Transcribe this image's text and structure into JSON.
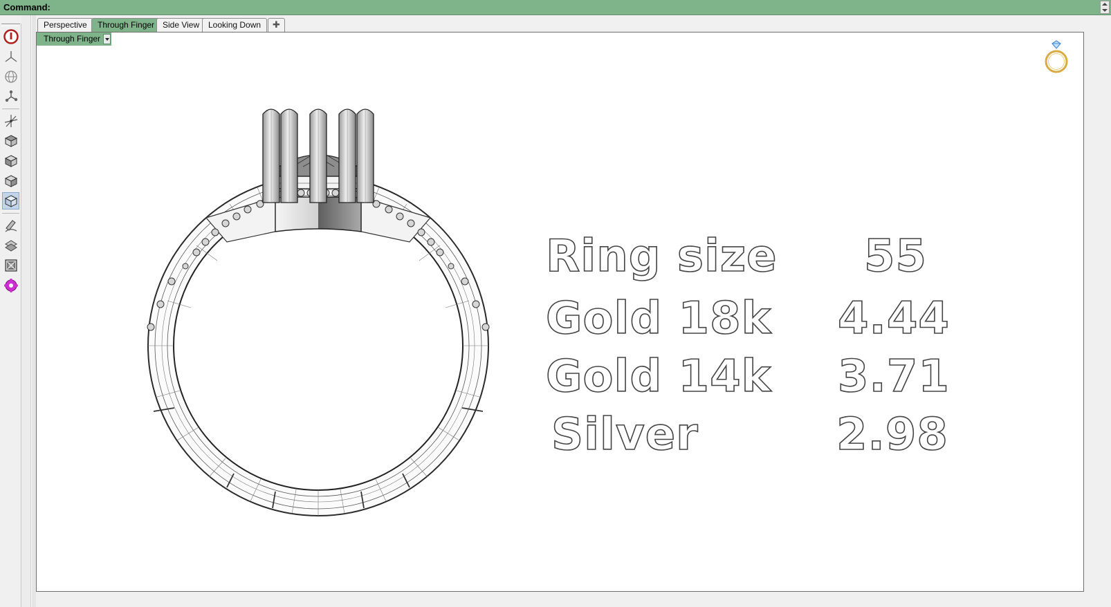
{
  "command": {
    "label": "Command:",
    "value": ""
  },
  "tabs": [
    {
      "label": "Perspective",
      "active": false
    },
    {
      "label": "Through Finger",
      "active": true
    },
    {
      "label": "Side View",
      "active": false
    },
    {
      "label": "Looking Down",
      "active": false
    }
  ],
  "tab_add_icon": "plus-icon",
  "viewport": {
    "title": "Through Finger"
  },
  "toolbar_icons": [
    "power-icon",
    "perspective-axes-icon",
    "globe-icon",
    "joint-icon",
    "gumball-icon",
    "cube-top-icon",
    "cube-front-icon",
    "cube-right-icon",
    "cube-iso-icon",
    "pencil-curve-icon",
    "transform-icon",
    "frame-icon",
    "plugin-gear-icon"
  ],
  "info": {
    "rows": [
      {
        "label": "Ring size",
        "value": "55"
      },
      {
        "label": "Gold 18k",
        "value": "4.44"
      },
      {
        "label": "Gold 14k",
        "value": "3.71"
      },
      {
        "label": "Silver",
        "value": "2.98"
      }
    ]
  },
  "colors": {
    "accent": "#7fb38a",
    "logo_gold": "#d8ab45",
    "logo_diamond": "#4b8fd4"
  }
}
